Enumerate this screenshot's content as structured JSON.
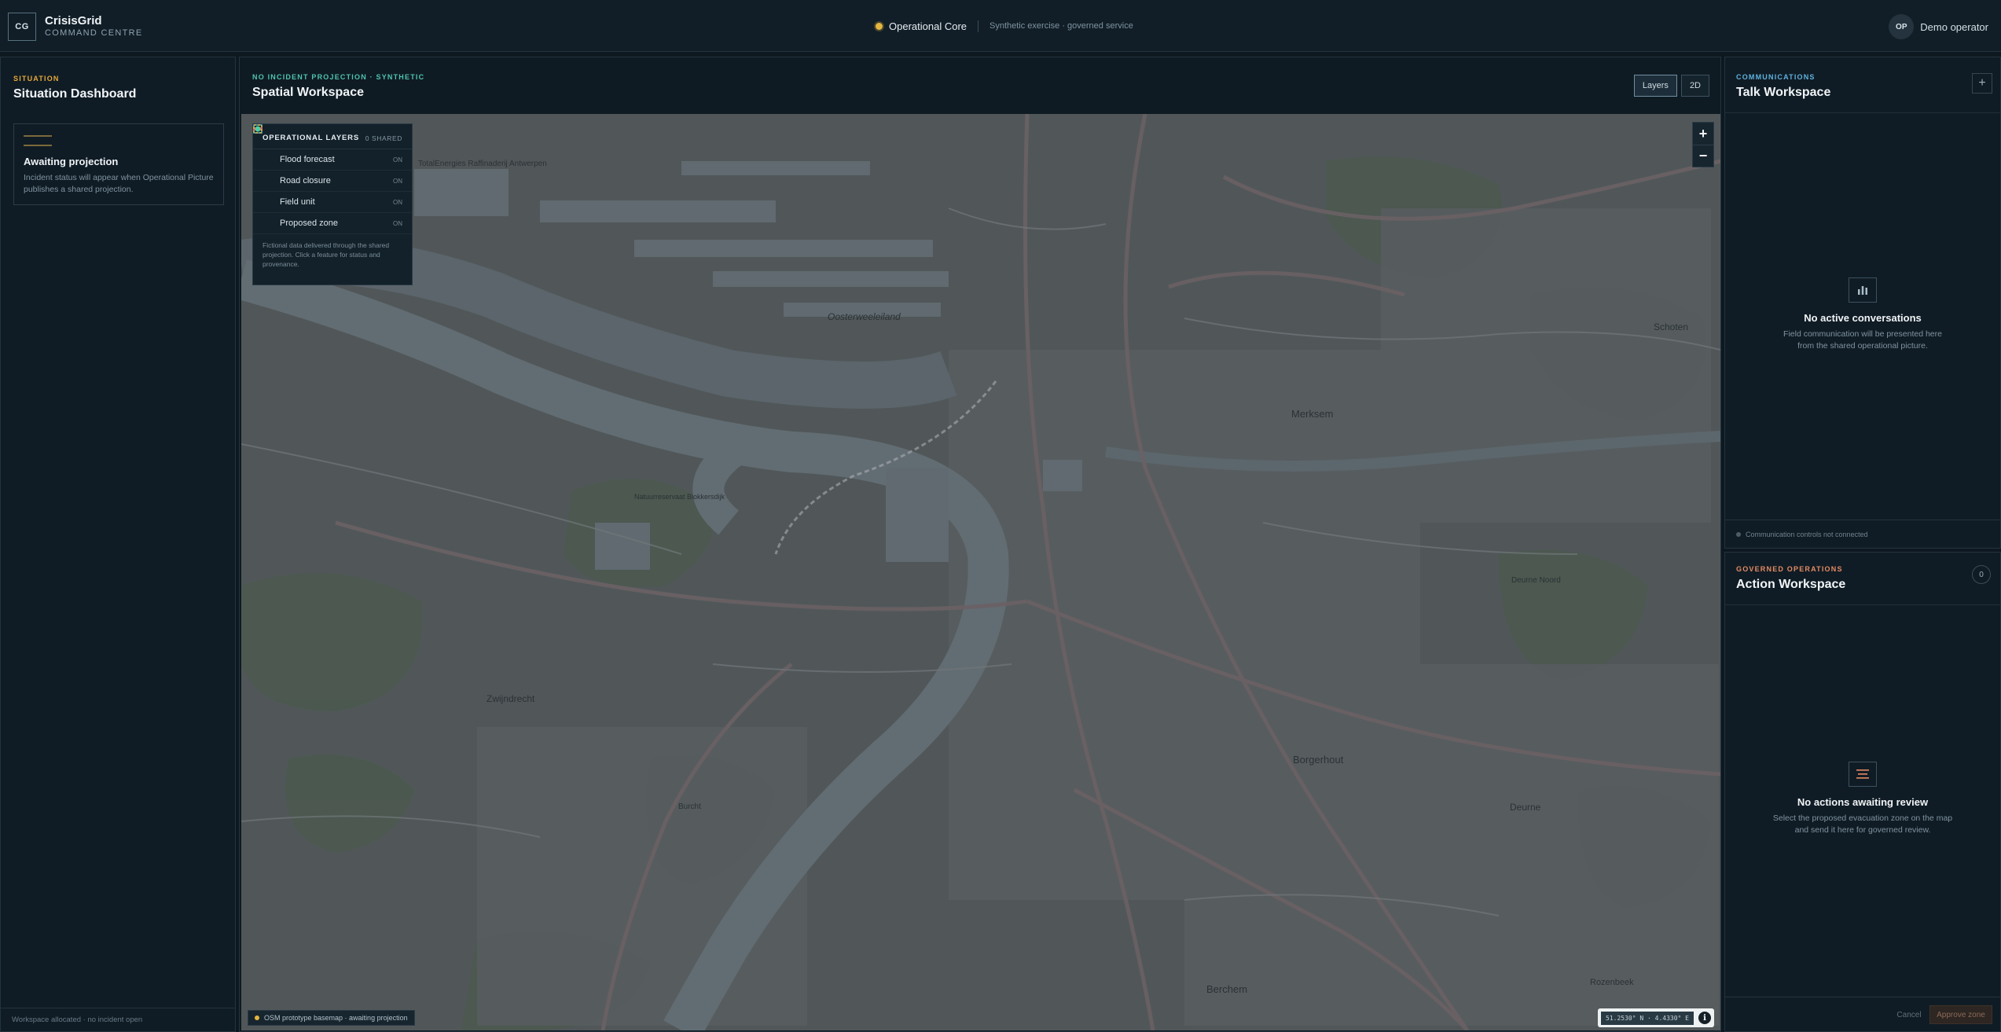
{
  "app": {
    "logo": "CG",
    "title": "CrisisGrid",
    "subtitle": "COMMAND CENTRE"
  },
  "status": {
    "label": "Operational Core",
    "note": "Synthetic exercise · governed service",
    "dot_color": "#e2b540"
  },
  "user": {
    "initials": "OP",
    "name": "Demo operator"
  },
  "situation": {
    "eyebrow": "SITUATION",
    "title": "Situation Dashboard",
    "card_title": "Awaiting projection",
    "card_text": "Incident status will appear when Operational Picture publishes a shared projection.",
    "footer": "Workspace allocated · no incident open"
  },
  "spatial": {
    "eyebrow": "NO INCIDENT PROJECTION · SYNTHETIC",
    "title": "Spatial Workspace",
    "btn_layers": "Layers",
    "btn_2d": "2D",
    "layers_title": "OPERATIONAL LAYERS",
    "layers_count": "0 SHARED",
    "layers": [
      {
        "label": "Flood forecast",
        "state": "ON",
        "icon": "flood-square-icon",
        "color": "#4fb6d6"
      },
      {
        "label": "Road closure",
        "state": "ON",
        "icon": "road-closure-icon",
        "color": "#e05d5d"
      },
      {
        "label": "Field unit",
        "state": "ON",
        "icon": "field-unit-dot-icon",
        "color": "#49d1a6"
      },
      {
        "label": "Proposed zone",
        "state": "ON",
        "icon": "zone-dashed-icon",
        "color": "#e2b540"
      }
    ],
    "layers_note": "Fictional data delivered through the shared projection. Click a feature for status and provenance.",
    "zoom_in": "+",
    "zoom_out": "−",
    "basemap_tag": "OSM prototype basemap · awaiting projection",
    "coords": "51.2530° N · 4.4330° E",
    "info": "i"
  },
  "map_labels": {
    "l1": "TotalEnergies Raffinaderij Antwerpen",
    "l2": "Oosterweeleiland",
    "l3": "Merksem",
    "l4": "Schoten",
    "l5": "Zwijndrecht",
    "l6": "Borgerhout",
    "l7": "Deurne",
    "l8": "Berchem",
    "l9": "Rozenbeek",
    "l10": "Deurne Noord",
    "l11": "Natuurreservaat Blokkersdijk",
    "l12": "Burcht"
  },
  "communications": {
    "eyebrow": "COMMUNICATIONS",
    "title": "Talk Workspace",
    "plus": "+",
    "empty_title": "No active conversations",
    "empty_text": "Field communication will be presented here from the shared operational picture.",
    "footer": "Communication controls not connected"
  },
  "actions": {
    "eyebrow": "GOVERNED OPERATIONS",
    "title": "Action Workspace",
    "count": "0",
    "empty_title": "No actions awaiting review",
    "empty_text": "Select the proposed evacuation zone on the map and send it here for governed review.",
    "cancel": "Cancel",
    "approve": "Approve zone"
  }
}
